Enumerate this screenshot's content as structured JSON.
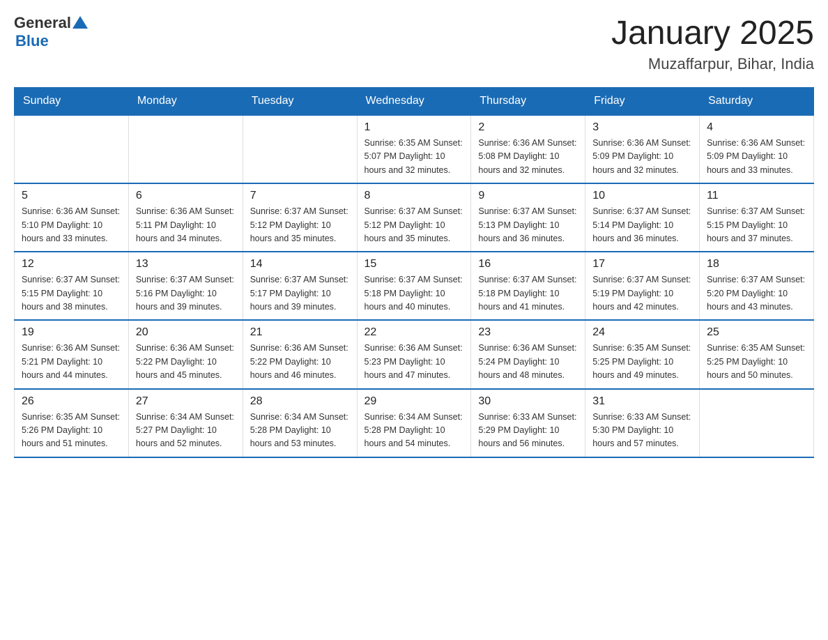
{
  "logo": {
    "general": "General",
    "blue": "Blue",
    "triangle": "▲"
  },
  "title": "January 2025",
  "location": "Muzaffarpur, Bihar, India",
  "days_of_week": [
    "Sunday",
    "Monday",
    "Tuesday",
    "Wednesday",
    "Thursday",
    "Friday",
    "Saturday"
  ],
  "weeks": [
    [
      {
        "day": "",
        "info": ""
      },
      {
        "day": "",
        "info": ""
      },
      {
        "day": "",
        "info": ""
      },
      {
        "day": "1",
        "info": "Sunrise: 6:35 AM\nSunset: 5:07 PM\nDaylight: 10 hours\nand 32 minutes."
      },
      {
        "day": "2",
        "info": "Sunrise: 6:36 AM\nSunset: 5:08 PM\nDaylight: 10 hours\nand 32 minutes."
      },
      {
        "day": "3",
        "info": "Sunrise: 6:36 AM\nSunset: 5:09 PM\nDaylight: 10 hours\nand 32 minutes."
      },
      {
        "day": "4",
        "info": "Sunrise: 6:36 AM\nSunset: 5:09 PM\nDaylight: 10 hours\nand 33 minutes."
      }
    ],
    [
      {
        "day": "5",
        "info": "Sunrise: 6:36 AM\nSunset: 5:10 PM\nDaylight: 10 hours\nand 33 minutes."
      },
      {
        "day": "6",
        "info": "Sunrise: 6:36 AM\nSunset: 5:11 PM\nDaylight: 10 hours\nand 34 minutes."
      },
      {
        "day": "7",
        "info": "Sunrise: 6:37 AM\nSunset: 5:12 PM\nDaylight: 10 hours\nand 35 minutes."
      },
      {
        "day": "8",
        "info": "Sunrise: 6:37 AM\nSunset: 5:12 PM\nDaylight: 10 hours\nand 35 minutes."
      },
      {
        "day": "9",
        "info": "Sunrise: 6:37 AM\nSunset: 5:13 PM\nDaylight: 10 hours\nand 36 minutes."
      },
      {
        "day": "10",
        "info": "Sunrise: 6:37 AM\nSunset: 5:14 PM\nDaylight: 10 hours\nand 36 minutes."
      },
      {
        "day": "11",
        "info": "Sunrise: 6:37 AM\nSunset: 5:15 PM\nDaylight: 10 hours\nand 37 minutes."
      }
    ],
    [
      {
        "day": "12",
        "info": "Sunrise: 6:37 AM\nSunset: 5:15 PM\nDaylight: 10 hours\nand 38 minutes."
      },
      {
        "day": "13",
        "info": "Sunrise: 6:37 AM\nSunset: 5:16 PM\nDaylight: 10 hours\nand 39 minutes."
      },
      {
        "day": "14",
        "info": "Sunrise: 6:37 AM\nSunset: 5:17 PM\nDaylight: 10 hours\nand 39 minutes."
      },
      {
        "day": "15",
        "info": "Sunrise: 6:37 AM\nSunset: 5:18 PM\nDaylight: 10 hours\nand 40 minutes."
      },
      {
        "day": "16",
        "info": "Sunrise: 6:37 AM\nSunset: 5:18 PM\nDaylight: 10 hours\nand 41 minutes."
      },
      {
        "day": "17",
        "info": "Sunrise: 6:37 AM\nSunset: 5:19 PM\nDaylight: 10 hours\nand 42 minutes."
      },
      {
        "day": "18",
        "info": "Sunrise: 6:37 AM\nSunset: 5:20 PM\nDaylight: 10 hours\nand 43 minutes."
      }
    ],
    [
      {
        "day": "19",
        "info": "Sunrise: 6:36 AM\nSunset: 5:21 PM\nDaylight: 10 hours\nand 44 minutes."
      },
      {
        "day": "20",
        "info": "Sunrise: 6:36 AM\nSunset: 5:22 PM\nDaylight: 10 hours\nand 45 minutes."
      },
      {
        "day": "21",
        "info": "Sunrise: 6:36 AM\nSunset: 5:22 PM\nDaylight: 10 hours\nand 46 minutes."
      },
      {
        "day": "22",
        "info": "Sunrise: 6:36 AM\nSunset: 5:23 PM\nDaylight: 10 hours\nand 47 minutes."
      },
      {
        "day": "23",
        "info": "Sunrise: 6:36 AM\nSunset: 5:24 PM\nDaylight: 10 hours\nand 48 minutes."
      },
      {
        "day": "24",
        "info": "Sunrise: 6:35 AM\nSunset: 5:25 PM\nDaylight: 10 hours\nand 49 minutes."
      },
      {
        "day": "25",
        "info": "Sunrise: 6:35 AM\nSunset: 5:25 PM\nDaylight: 10 hours\nand 50 minutes."
      }
    ],
    [
      {
        "day": "26",
        "info": "Sunrise: 6:35 AM\nSunset: 5:26 PM\nDaylight: 10 hours\nand 51 minutes."
      },
      {
        "day": "27",
        "info": "Sunrise: 6:34 AM\nSunset: 5:27 PM\nDaylight: 10 hours\nand 52 minutes."
      },
      {
        "day": "28",
        "info": "Sunrise: 6:34 AM\nSunset: 5:28 PM\nDaylight: 10 hours\nand 53 minutes."
      },
      {
        "day": "29",
        "info": "Sunrise: 6:34 AM\nSunset: 5:28 PM\nDaylight: 10 hours\nand 54 minutes."
      },
      {
        "day": "30",
        "info": "Sunrise: 6:33 AM\nSunset: 5:29 PM\nDaylight: 10 hours\nand 56 minutes."
      },
      {
        "day": "31",
        "info": "Sunrise: 6:33 AM\nSunset: 5:30 PM\nDaylight: 10 hours\nand 57 minutes."
      },
      {
        "day": "",
        "info": ""
      }
    ]
  ]
}
